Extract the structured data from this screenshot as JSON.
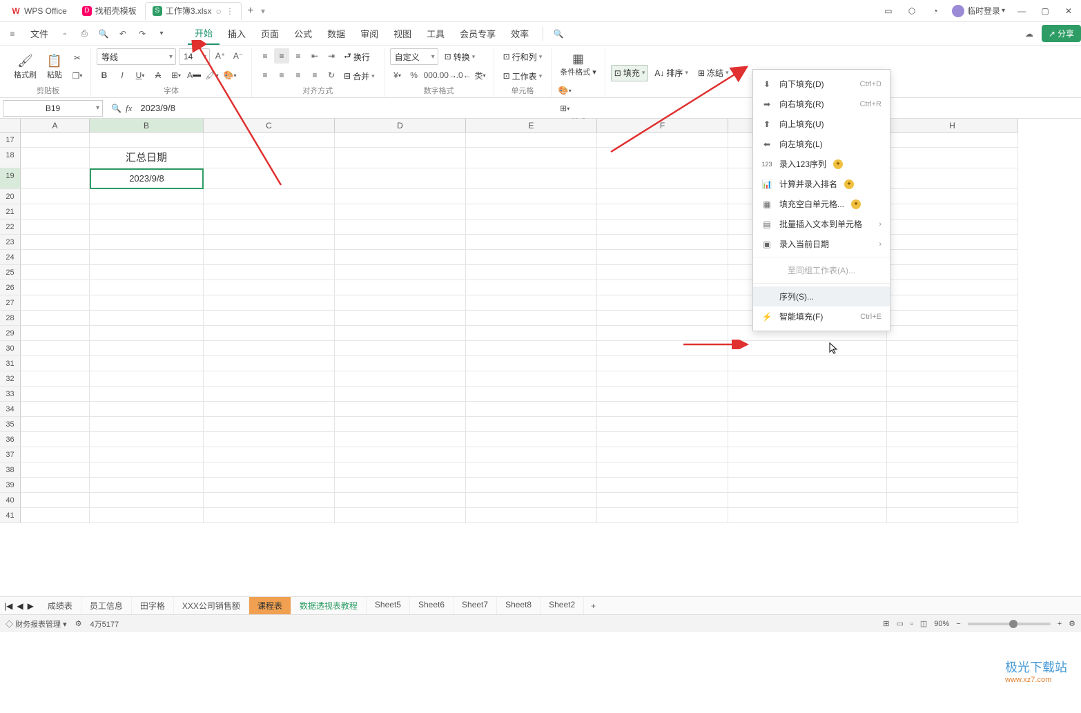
{
  "titlebar": {
    "tabs": [
      {
        "icon": "W",
        "label": "WPS Office",
        "bg": "#d33"
      },
      {
        "icon": "D",
        "label": "找稻壳模板",
        "bg": "#f06"
      },
      {
        "icon": "S",
        "label": "工作簿3.xlsx",
        "bg": "#2d9d65",
        "active": true
      }
    ],
    "login": "临时登录"
  },
  "menus": {
    "file": "文件",
    "items": [
      "开始",
      "插入",
      "页面",
      "公式",
      "数据",
      "审阅",
      "视图",
      "工具",
      "会员专享",
      "效率"
    ],
    "active": 0
  },
  "ribbon": {
    "clipboard": {
      "label": "剪贴板",
      "format": "格式刷",
      "paste": "粘贴"
    },
    "font": {
      "name": "等线",
      "size": "14",
      "label": "字体"
    },
    "align": {
      "wrap": "换行",
      "merge": "合并",
      "label": "对齐方式"
    },
    "number": {
      "custom": "自定义",
      "convert": "转换",
      "label": "数字格式"
    },
    "cells": {
      "rowcol": "行和列",
      "sheet": "工作表",
      "label": "单元格"
    },
    "style": {
      "condfmt": "条件格式",
      "label": "样式"
    },
    "edit": {
      "fill": "填充",
      "sort": "排序",
      "freeze": "冻结"
    }
  },
  "share": "分享",
  "namebox": "B19",
  "formula": "2023/9/8",
  "gridcells": {
    "B18": "汇总日期",
    "B19": "2023/9/8"
  },
  "cols": [
    "A",
    "B",
    "C",
    "D",
    "E",
    "F",
    "G",
    "H"
  ],
  "rows": [
    "17",
    "18",
    "19",
    "20",
    "21",
    "22",
    "23",
    "24",
    "25",
    "26",
    "27",
    "28",
    "29",
    "30",
    "31",
    "32",
    "33",
    "34",
    "35",
    "36",
    "37",
    "38",
    "39",
    "40",
    "41"
  ],
  "filldrop": {
    "items": [
      {
        "icon": "↓",
        "label": "向下填充(D)",
        "sc": "Ctrl+D"
      },
      {
        "icon": "→",
        "label": "向右填充(R)",
        "sc": "Ctrl+R"
      },
      {
        "icon": "↑",
        "label": "向上填充(U)"
      },
      {
        "icon": "←",
        "label": "向左填充(L)"
      },
      {
        "icon": "123",
        "label": "录入123序列",
        "gold": true
      },
      {
        "icon": "#",
        "label": "计算并录入排名",
        "gold": true
      },
      {
        "icon": "▦",
        "label": "填充空白单元格...",
        "gold": true
      },
      {
        "icon": "▤",
        "label": "批量插入文本到单元格",
        "sub": true
      },
      {
        "icon": "📅",
        "label": "录入当前日期",
        "sub": true
      },
      {
        "icon": "",
        "label": "至同组工作表(A)...",
        "disabled": true
      },
      {
        "icon": "",
        "label": "序列(S)...",
        "hover": true
      },
      {
        "icon": "⚡",
        "label": "智能填充(F)",
        "sc": "Ctrl+E"
      }
    ]
  },
  "sheettabs": [
    "成绩表",
    "员工信息",
    "田字格",
    "XXX公司销售额",
    "课程表",
    "数据透视表教程",
    "Sheet5",
    "Sheet6",
    "Sheet7",
    "Sheet8",
    "Sheet2"
  ],
  "sheetactive": 4,
  "sheetgreen": 5,
  "statusbar": {
    "left": "财务报表管理",
    "count": "4万5177",
    "zoom": "90%"
  },
  "watermark": {
    "title": "极光下载站",
    "url": "www.xz7.com"
  }
}
